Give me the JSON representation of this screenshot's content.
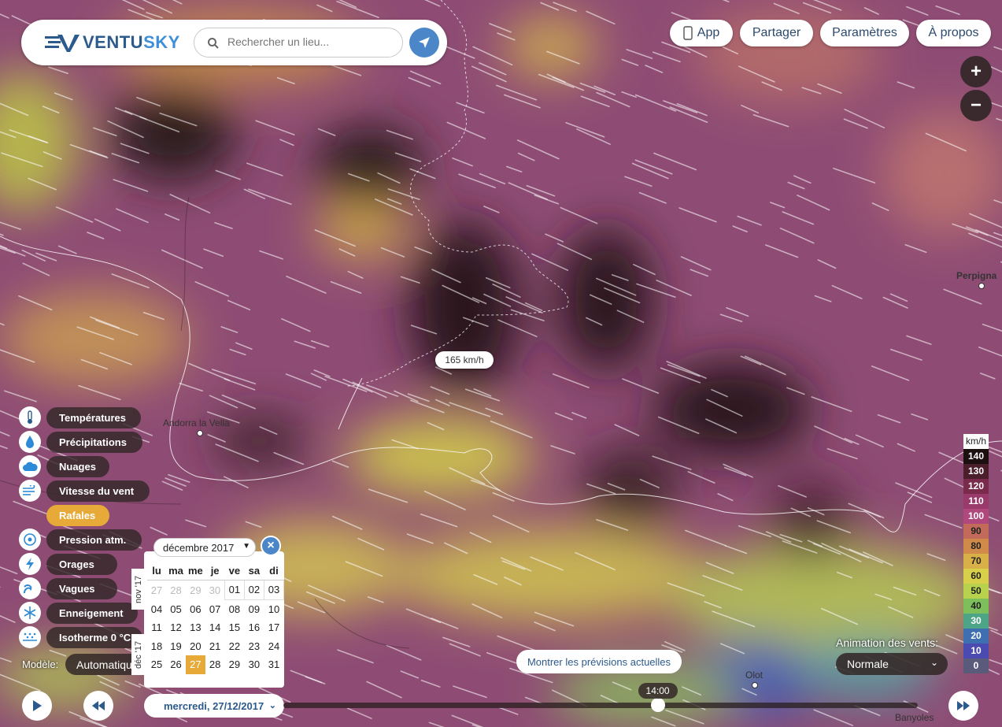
{
  "brand": {
    "name_part1": "VENTU",
    "name_part2": "SKY"
  },
  "search": {
    "placeholder": "Rechercher un lieu..."
  },
  "nav": {
    "app": "App",
    "share": "Partager",
    "settings": "Paramètres",
    "about": "À propos"
  },
  "zoom": {
    "in": "+",
    "out": "−"
  },
  "map": {
    "wind_label": "165 km/h",
    "places": {
      "andorra": "Andorra la Vella",
      "perpignan": "Perpigna",
      "olot": "Olot",
      "banyoles": "Banyoles"
    }
  },
  "layers": [
    {
      "label": "Températures",
      "icon": "thermometer-icon"
    },
    {
      "label": "Précipitations",
      "icon": "drop-icon"
    },
    {
      "label": "Nuages",
      "icon": "cloud-icon"
    },
    {
      "label": "Vitesse du vent",
      "icon": "wind-icon"
    },
    {
      "label": "Rafales",
      "icon": "",
      "active": true
    },
    {
      "label": "Pression atm.",
      "icon": "pressure-icon"
    },
    {
      "label": "Orages",
      "icon": "lightning-icon"
    },
    {
      "label": "Vagues",
      "icon": "waves-icon"
    },
    {
      "label": "Enneigement",
      "icon": "snowflake-icon"
    },
    {
      "label": "Isotherme 0 °C",
      "icon": "isotherm-icon"
    }
  ],
  "model": {
    "label": "Modèle:",
    "value": "Automatique"
  },
  "calendar": {
    "month_select": "décembre 2017",
    "close": "×",
    "side_prev": "nov '17",
    "side_cur": "déc '17",
    "weekdays": [
      "lu",
      "ma",
      "me",
      "je",
      "ve",
      "sa",
      "di"
    ],
    "rows": [
      [
        "27",
        "28",
        "29",
        "30",
        "01",
        "02",
        "03"
      ],
      [
        "04",
        "05",
        "06",
        "07",
        "08",
        "09",
        "10"
      ],
      [
        "11",
        "12",
        "13",
        "14",
        "15",
        "16",
        "17"
      ],
      [
        "18",
        "19",
        "20",
        "21",
        "22",
        "23",
        "24"
      ],
      [
        "25",
        "26",
        "27",
        "28",
        "29",
        "30",
        "31"
      ]
    ],
    "today": "27"
  },
  "date_display": "mercredi, 27/12/2017",
  "timeline": {
    "time": "14:00",
    "position": 0.59
  },
  "show_current": "Montrer les prévisions actuelles",
  "animation": {
    "label": "Animation des vents:",
    "value": "Normale"
  },
  "legend": {
    "unit": "km/h",
    "steps": [
      {
        "v": "140",
        "c": "#1c0f10",
        "t": "#fff"
      },
      {
        "v": "130",
        "c": "#4a1e2a",
        "t": "#fff"
      },
      {
        "v": "120",
        "c": "#7a2a4a",
        "t": "#fff"
      },
      {
        "v": "110",
        "c": "#9a3a6a",
        "t": "#fff"
      },
      {
        "v": "100",
        "c": "#b0487e",
        "t": "#fff"
      },
      {
        "v": "90",
        "c": "#c26b5a",
        "t": "#222"
      },
      {
        "v": "80",
        "c": "#d08a4a",
        "t": "#222"
      },
      {
        "v": "70",
        "c": "#d9b048",
        "t": "#222"
      },
      {
        "v": "60",
        "c": "#d8d04a",
        "t": "#222"
      },
      {
        "v": "50",
        "c": "#b8d24e",
        "t": "#222"
      },
      {
        "v": "40",
        "c": "#7dbf5a",
        "t": "#222"
      },
      {
        "v": "30",
        "c": "#4ea486",
        "t": "#fff"
      },
      {
        "v": "20",
        "c": "#3e6fb0",
        "t": "#fff"
      },
      {
        "v": "10",
        "c": "#4a4ab0",
        "t": "#fff"
      },
      {
        "v": "0",
        "c": "#5a5a7a",
        "t": "#fff"
      }
    ]
  }
}
